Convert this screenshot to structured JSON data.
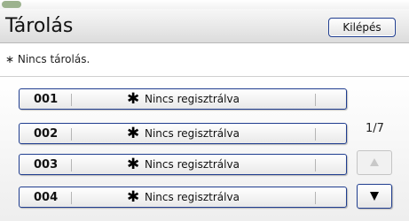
{
  "header": {
    "title": "Tárolás",
    "exit_label": "Kilépés"
  },
  "note": "∗ Nincs tárolás.",
  "slots": [
    {
      "number": "001",
      "star": "✱",
      "label": "Nincs regisztrálva"
    },
    {
      "number": "002",
      "star": "✱",
      "label": "Nincs regisztrálva"
    },
    {
      "number": "003",
      "star": "✱",
      "label": "Nincs regisztrálva"
    },
    {
      "number": "004",
      "star": "✱",
      "label": "Nincs regisztrálva"
    }
  ],
  "pagination": {
    "indicator": "1/7",
    "up_icon": "triangle-up-icon",
    "down_icon": "triangle-down-icon",
    "up_enabled": false,
    "down_enabled": true
  },
  "colors": {
    "button_border": "#1f3d8f",
    "disabled_icon": "#c8c8c8",
    "enabled_icon": "#000000"
  }
}
